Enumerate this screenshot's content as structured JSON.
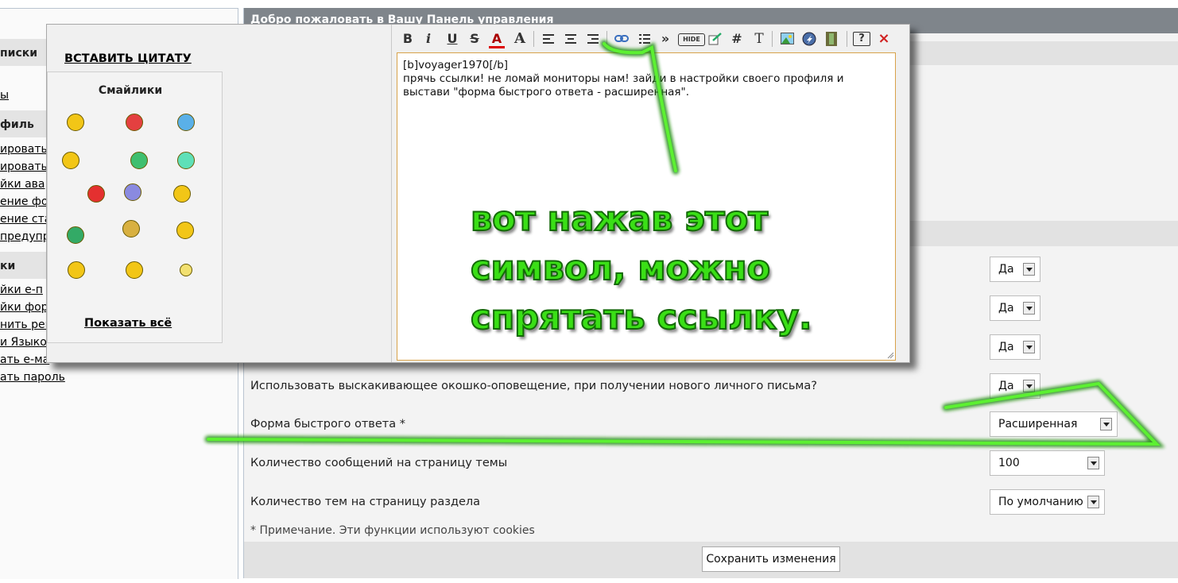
{
  "sidebar": {
    "headers": [
      "писки",
      "филь",
      "ки"
    ],
    "links": [
      "ы",
      "ировать",
      "ировать",
      "йки ава",
      "ение фо",
      "ение ста",
      "предупр",
      "йки е-п",
      "йки фор",
      "нить рек",
      "и Языко",
      "ать е-ма",
      "ать пароль"
    ]
  },
  "main": {
    "title": "Добро пожаловать в Вашу Панель управления",
    "options": [
      {
        "label": "",
        "value": "Да"
      },
      {
        "label": "",
        "value": "Да"
      },
      {
        "label": "",
        "value": "Да"
      },
      {
        "label": "Использовать выскакивающее окошко-оповещение, при получении нового личного письма?",
        "value": "Да"
      },
      {
        "label": "Форма быстрого ответа *",
        "value": "Расширенная"
      },
      {
        "label": "Количество сообщений на страницу темы",
        "value": "100"
      },
      {
        "label": "Количество тем на страницу раздела",
        "value": "По умолчанию"
      }
    ],
    "note": "* Примечание. Эти функции используют cookies",
    "save_label": "Сохранить изменения"
  },
  "popup": {
    "quote_label": "ВСТАВИТЬ ЦИТАТУ",
    "smilies_title": "Смайлики",
    "show_all": "Показать всё",
    "toolbar": {
      "bold": "B",
      "italic": "i",
      "underline": "U",
      "strike": "S",
      "color": "A",
      "font": "A",
      "quote": "»",
      "hide": "HIDE",
      "hash": "#",
      "text": "T",
      "help": "?",
      "close": "×"
    },
    "editor": {
      "lines": [
        "[b]voyager1970[/b]",
        "прячь ссылки! не ломай мониторы нам! зайди в настройки своего профиля и",
        "выстави \"форма быстрого ответа - расширенная\"."
      ]
    },
    "smiley_colors": [
      "#f2c617",
      "#e44040",
      "#5ab0e8",
      "#f2c617",
      "#3fbf6f",
      "#5fe0b8",
      "#e43030",
      "#8a8ae0",
      "#f2c617",
      "#33aa66",
      "#d8b040",
      "#f2c617",
      "#f2c617",
      "#f2c617",
      "#f2e070"
    ]
  },
  "annotation": {
    "lines": [
      "вот нажав этот",
      "символ, можно",
      "спрятать ссылку."
    ],
    "color": "#3adf16"
  }
}
